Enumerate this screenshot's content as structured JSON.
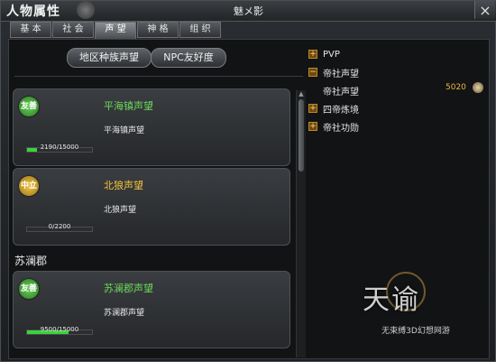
{
  "window": {
    "title": "人物属性",
    "character_name": "魅メ影",
    "close_glyph": "×"
  },
  "tabs": [
    "基 本",
    "社 会",
    "声 望",
    "神 格",
    "组 织"
  ],
  "active_tab_index": 2,
  "filters": {
    "region_label": "地区种族声望",
    "npc_label": "NPC友好度"
  },
  "reputation_cards": [
    {
      "badge": "友善",
      "badge_color": "#3fae32",
      "title": "平海镇声望",
      "subtitle": "平海镇声望",
      "progress_text": "2190/15000",
      "progress_fraction": 0.146
    },
    {
      "badge": "中立",
      "badge_color": "#d0a22a",
      "title": "北狼声望",
      "subtitle": "北狼声望",
      "progress_text": "0/2200",
      "progress_fraction": 0.0
    },
    {
      "badge": "友善",
      "badge_color": "#3fae32",
      "title": "苏澜郡声望",
      "subtitle": "苏澜郡声望",
      "progress_text": "9500/15000",
      "progress_fraction": 0.633
    }
  ],
  "region_heading": "苏澜郡",
  "tree": {
    "pvp": {
      "label": "PVP",
      "state": "+"
    },
    "imperial": {
      "label": "帝社声望",
      "state": "−"
    },
    "imperial_child": {
      "label": "帝社声望",
      "value": "5020"
    },
    "refine": {
      "label": "四帝炼境",
      "state": "+"
    },
    "merit": {
      "label": "帝社功勋",
      "state": "+"
    }
  },
  "logo": {
    "text": "天谕",
    "slogan": "无束缚3D幻想网游"
  },
  "colors": {
    "friendly": "#6cd85a",
    "neutral": "#f0c23a",
    "progress": "#3ad33a"
  }
}
